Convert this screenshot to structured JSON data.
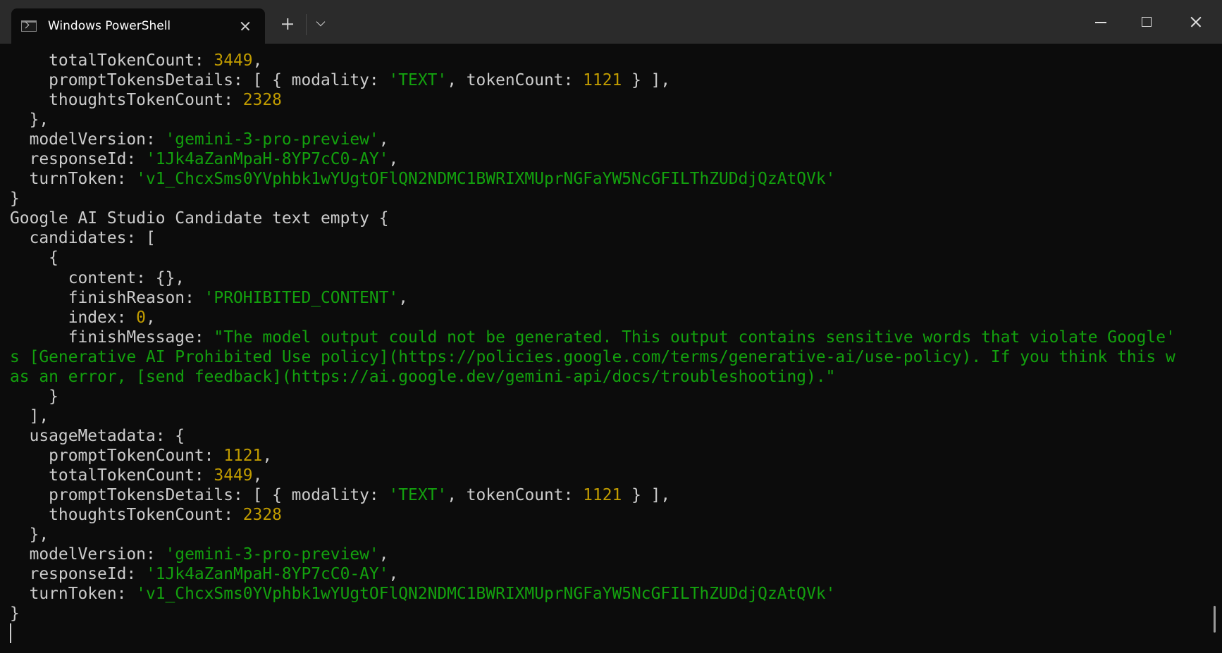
{
  "window": {
    "tab_title": "Windows PowerShell",
    "icon": "powershell-terminal-icon",
    "new_tab_icon": "plus-icon",
    "dropdown_icon": "chevron-down-icon",
    "minimize_icon": "minimize-icon",
    "maximize_icon": "maximize-icon",
    "close_icon": "close-icon"
  },
  "colors": {
    "background": "#0c0c0c",
    "titlebar": "#2b2b2b",
    "text": "#cccccc",
    "number": "#c19c00",
    "string": "#13a10e"
  },
  "terminal": {
    "lines": [
      [
        {
          "t": "    totalTokenCount: ",
          "c": "key"
        },
        {
          "t": "3449",
          "c": "num"
        },
        {
          "t": ",",
          "c": "key"
        }
      ],
      [
        {
          "t": "    promptTokensDetails: [ { modality: ",
          "c": "key"
        },
        {
          "t": "'TEXT'",
          "c": "str"
        },
        {
          "t": ", tokenCount: ",
          "c": "key"
        },
        {
          "t": "1121",
          "c": "num"
        },
        {
          "t": " } ],",
          "c": "key"
        }
      ],
      [
        {
          "t": "    thoughtsTokenCount: ",
          "c": "key"
        },
        {
          "t": "2328",
          "c": "num"
        }
      ],
      [
        {
          "t": "  },",
          "c": "key"
        }
      ],
      [
        {
          "t": "  modelVersion: ",
          "c": "key"
        },
        {
          "t": "'gemini-3-pro-preview'",
          "c": "str"
        },
        {
          "t": ",",
          "c": "key"
        }
      ],
      [
        {
          "t": "  responseId: ",
          "c": "key"
        },
        {
          "t": "'1Jk4aZanMpaH-8YP7cC0-AY'",
          "c": "str"
        },
        {
          "t": ",",
          "c": "key"
        }
      ],
      [
        {
          "t": "  turnToken: ",
          "c": "key"
        },
        {
          "t": "'v1_ChcxSms0YVphbk1wYUgtOFlQN2NDMC1BWRIXMUprNGFaYW5NcGFILThZUDdjQzAtQVk'",
          "c": "str"
        }
      ],
      [
        {
          "t": "}",
          "c": "key"
        }
      ],
      [
        {
          "t": "Google AI Studio Candidate text empty {",
          "c": "key"
        }
      ],
      [
        {
          "t": "  candidates: [",
          "c": "key"
        }
      ],
      [
        {
          "t": "    {",
          "c": "key"
        }
      ],
      [
        {
          "t": "      content: {},",
          "c": "key"
        }
      ],
      [
        {
          "t": "      finishReason: ",
          "c": "key"
        },
        {
          "t": "'PROHIBITED_CONTENT'",
          "c": "str"
        },
        {
          "t": ",",
          "c": "key"
        }
      ],
      [
        {
          "t": "      index: ",
          "c": "key"
        },
        {
          "t": "0",
          "c": "num"
        },
        {
          "t": ",",
          "c": "key"
        }
      ],
      [
        {
          "t": "      finishMessage: ",
          "c": "key"
        },
        {
          "t": "\"The model output could not be generated. This output contains sensitive words that violate Google'",
          "c": "str"
        }
      ],
      [
        {
          "t": "s [Generative AI Prohibited Use policy](https://policies.google.com/terms/generative-ai/use-policy). If you think this w",
          "c": "str"
        }
      ],
      [
        {
          "t": "as an error, [send feedback](https://ai.google.dev/gemini-api/docs/troubleshooting).\"",
          "c": "str"
        }
      ],
      [
        {
          "t": "    }",
          "c": "key"
        }
      ],
      [
        {
          "t": "  ],",
          "c": "key"
        }
      ],
      [
        {
          "t": "  usageMetadata: {",
          "c": "key"
        }
      ],
      [
        {
          "t": "    promptTokenCount: ",
          "c": "key"
        },
        {
          "t": "1121",
          "c": "num"
        },
        {
          "t": ",",
          "c": "key"
        }
      ],
      [
        {
          "t": "    totalTokenCount: ",
          "c": "key"
        },
        {
          "t": "3449",
          "c": "num"
        },
        {
          "t": ",",
          "c": "key"
        }
      ],
      [
        {
          "t": "    promptTokensDetails: [ { modality: ",
          "c": "key"
        },
        {
          "t": "'TEXT'",
          "c": "str"
        },
        {
          "t": ", tokenCount: ",
          "c": "key"
        },
        {
          "t": "1121",
          "c": "num"
        },
        {
          "t": " } ],",
          "c": "key"
        }
      ],
      [
        {
          "t": "    thoughtsTokenCount: ",
          "c": "key"
        },
        {
          "t": "2328",
          "c": "num"
        }
      ],
      [
        {
          "t": "  },",
          "c": "key"
        }
      ],
      [
        {
          "t": "  modelVersion: ",
          "c": "key"
        },
        {
          "t": "'gemini-3-pro-preview'",
          "c": "str"
        },
        {
          "t": ",",
          "c": "key"
        }
      ],
      [
        {
          "t": "  responseId: ",
          "c": "key"
        },
        {
          "t": "'1Jk4aZanMpaH-8YP7cC0-AY'",
          "c": "str"
        },
        {
          "t": ",",
          "c": "key"
        }
      ],
      [
        {
          "t": "  turnToken: ",
          "c": "key"
        },
        {
          "t": "'v1_ChcxSms0YVphbk1wYUgtOFlQN2NDMC1BWRIXMUprNGFaYW5NcGFILThZUDdjQzAtQVk'",
          "c": "str"
        }
      ],
      [
        {
          "t": "}",
          "c": "key"
        }
      ],
      []
    ]
  }
}
